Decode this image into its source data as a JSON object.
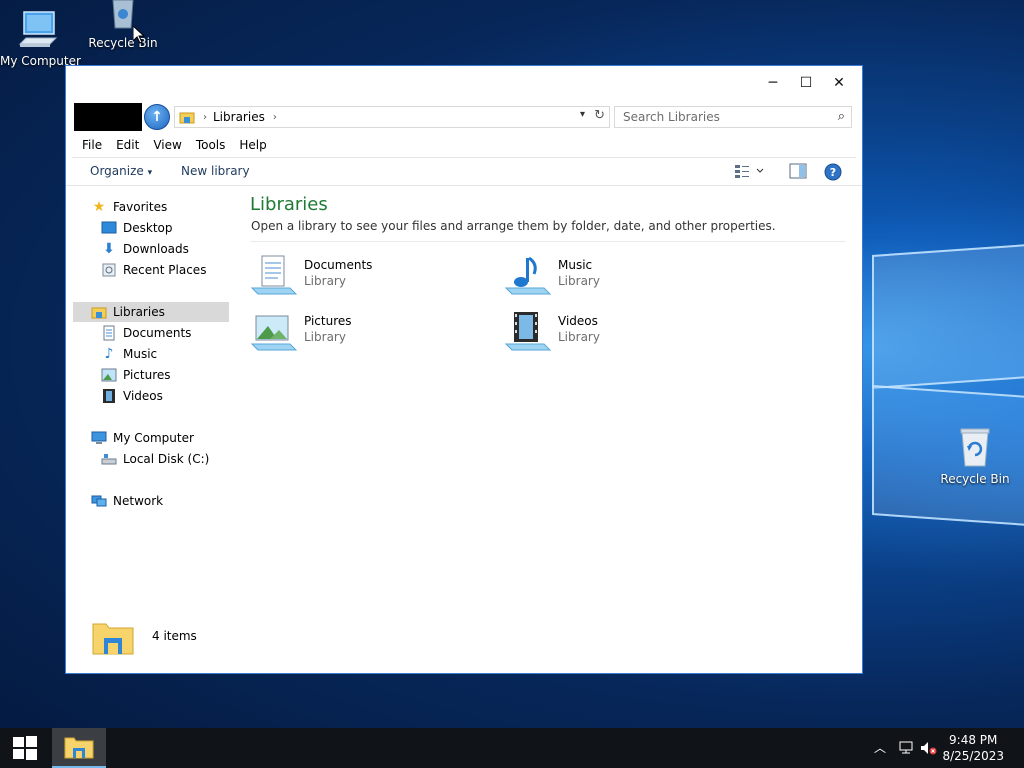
{
  "desktop": {
    "icons": [
      {
        "label": "My Computer",
        "icon": "computer-icon"
      },
      {
        "label": "Recycle Bin",
        "icon": "recycle-bin-icon"
      },
      {
        "label": "Recycle Bin",
        "icon": "recycle-bin-icon"
      }
    ]
  },
  "window": {
    "controls": {
      "minimize": "─",
      "maximize": "☐",
      "close": "✕"
    },
    "address": {
      "crumbs": [
        "Libraries"
      ],
      "search_placeholder": "Search Libraries"
    },
    "menu": [
      "File",
      "Edit",
      "View",
      "Tools",
      "Help"
    ],
    "toolbar": {
      "organize": "Organize",
      "new_library": "New library"
    },
    "nav": {
      "favorites": {
        "label": "Favorites",
        "items": [
          "Desktop",
          "Downloads",
          "Recent Places"
        ]
      },
      "libraries": {
        "label": "Libraries",
        "items": [
          "Documents",
          "Music",
          "Pictures",
          "Videos"
        ]
      },
      "computer": {
        "label": "My Computer",
        "items": [
          "Local Disk (C:)"
        ]
      },
      "network": {
        "label": "Network"
      }
    },
    "content": {
      "title": "Libraries",
      "description": "Open a library to see your files and arrange them by folder, date, and other properties.",
      "tiles": [
        {
          "name": "Documents",
          "sub": "Library",
          "icon": "documents-library-icon"
        },
        {
          "name": "Music",
          "sub": "Library",
          "icon": "music-library-icon"
        },
        {
          "name": "Pictures",
          "sub": "Library",
          "icon": "pictures-library-icon"
        },
        {
          "name": "Videos",
          "sub": "Library",
          "icon": "videos-library-icon"
        }
      ]
    },
    "details": {
      "count": "4 items"
    }
  },
  "taskbar": {
    "time": "9:48 PM",
    "date": "8/25/2023"
  },
  "colors": {
    "title_green": "#1e7a34",
    "accent_blue": "#1f66c1"
  }
}
